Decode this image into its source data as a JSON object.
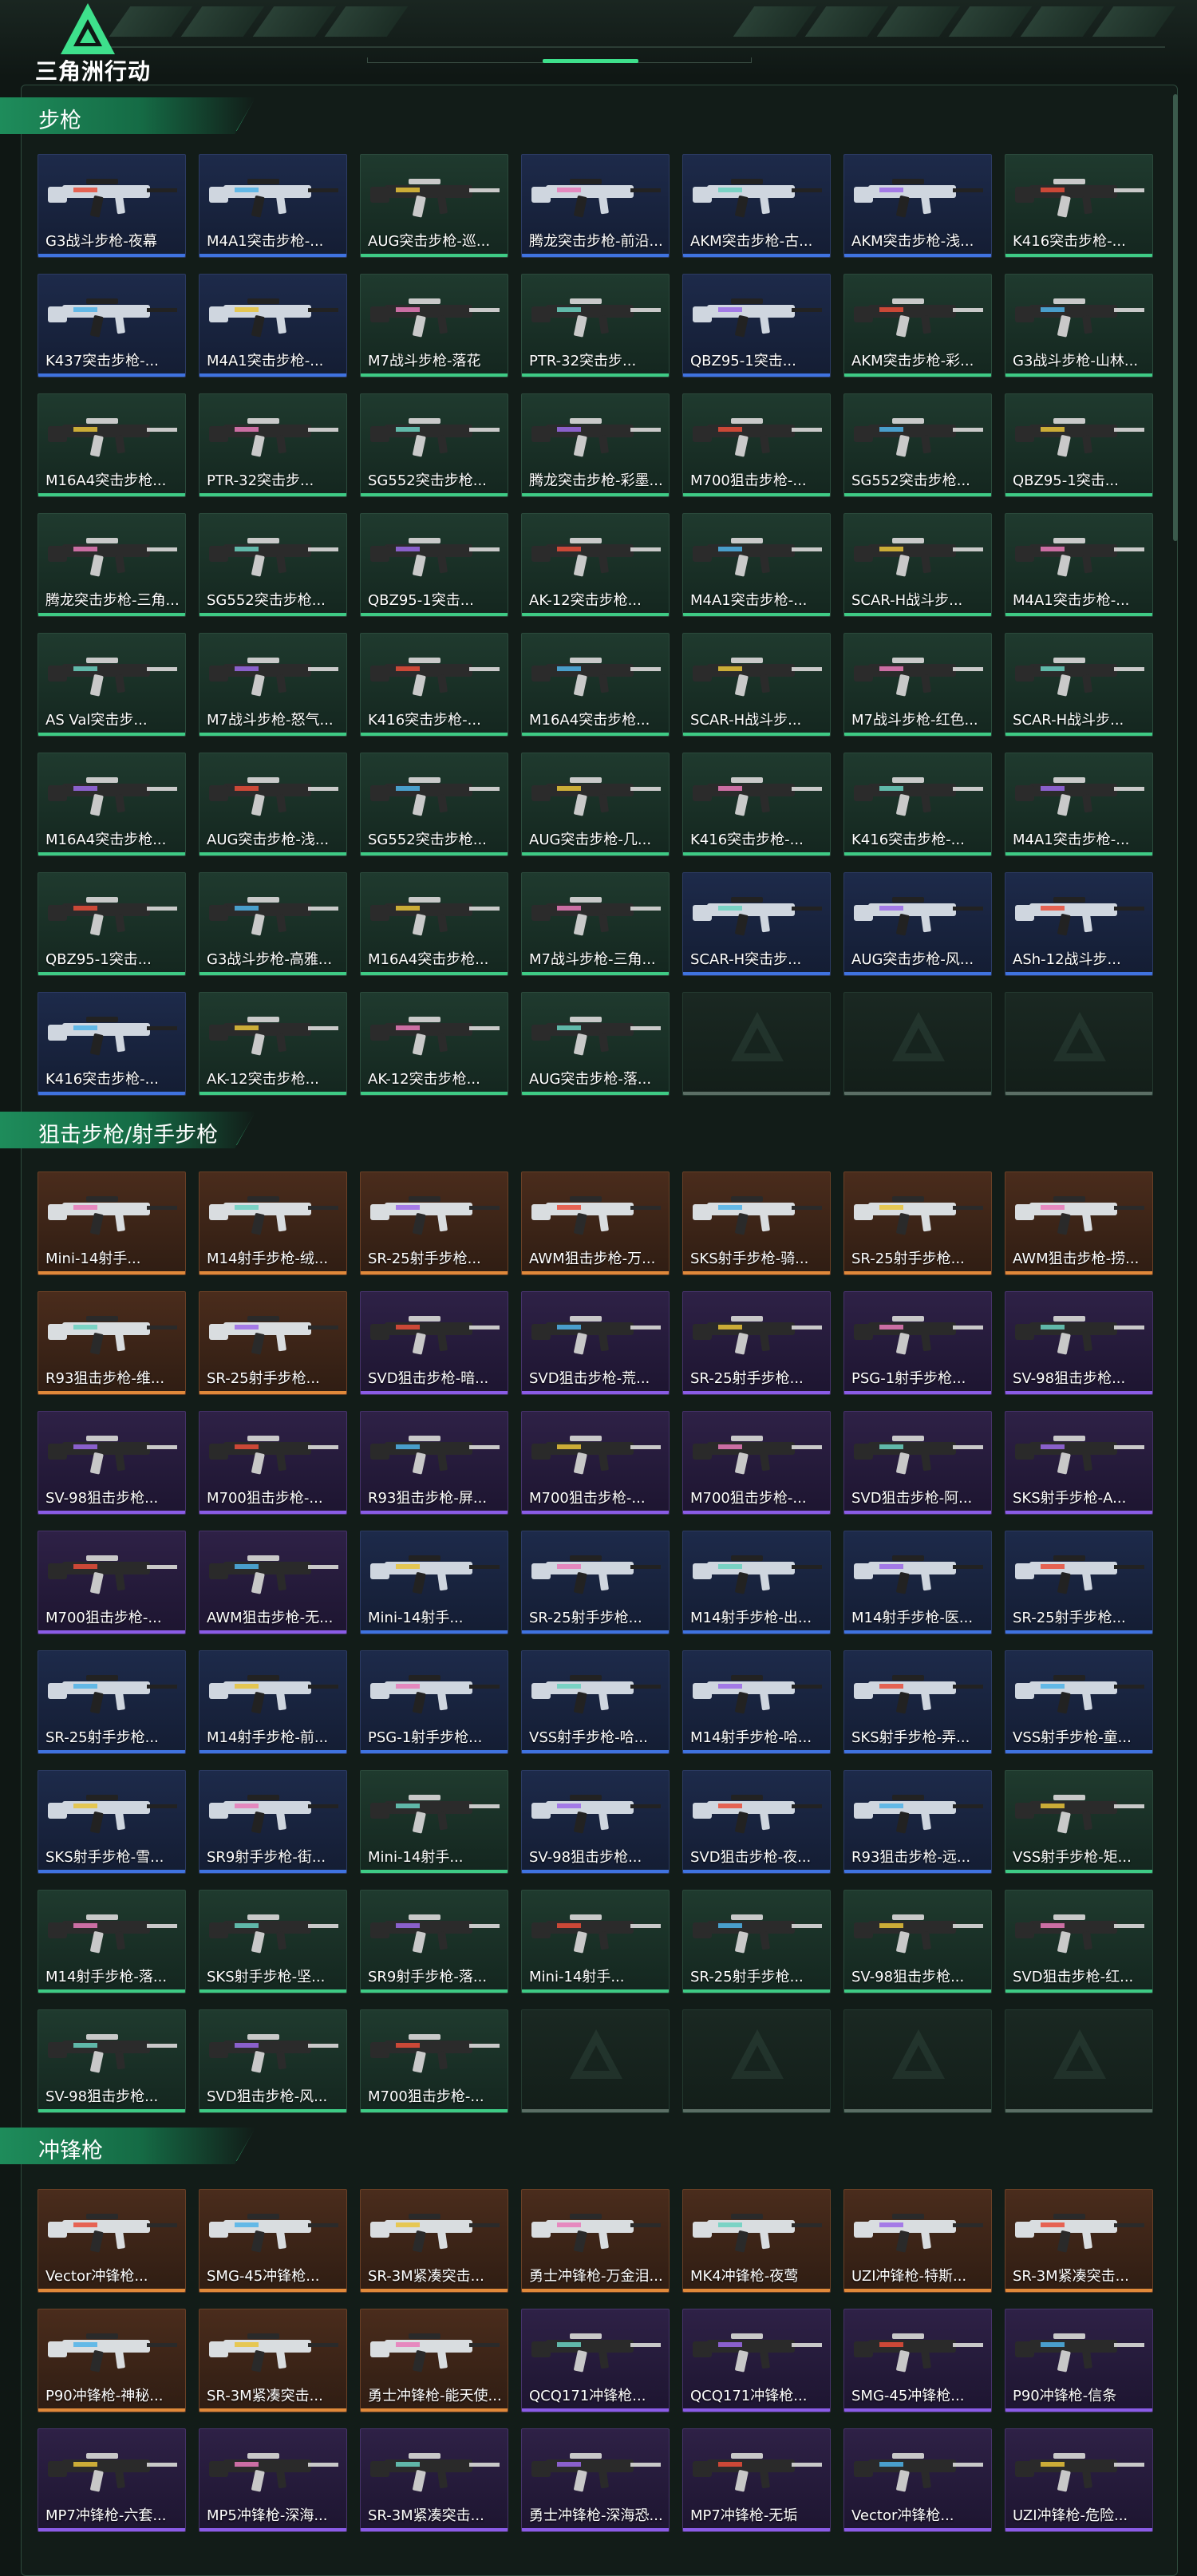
{
  "app": {
    "logo_text": "三角洲行动"
  },
  "colors": {
    "accent": "#3ee08c",
    "rarity_green": "#3ecb85",
    "rarity_blue": "#3f73e0",
    "rarity_purple": "#8a5ce6",
    "rarity_orange": "#e0893a"
  },
  "sections": [
    {
      "title": "步枪",
      "items": [
        {
          "label": "G3战斗步枪-夜幕",
          "rarity": "blue"
        },
        {
          "label": "M4A1突击步枪-...",
          "rarity": "blue"
        },
        {
          "label": "AUG突击步枪-巡...",
          "rarity": "green"
        },
        {
          "label": "腾龙突击步枪-前沿...",
          "rarity": "blue"
        },
        {
          "label": "AKM突击步枪-古...",
          "rarity": "blue"
        },
        {
          "label": "AKM突击步枪-浅...",
          "rarity": "blue"
        },
        {
          "label": "K416突击步枪-...",
          "rarity": "green"
        },
        {
          "label": "K437突击步枪-...",
          "rarity": "blue"
        },
        {
          "label": "M4A1突击步枪-...",
          "rarity": "blue"
        },
        {
          "label": "M7战斗步枪-落花",
          "rarity": "green"
        },
        {
          "label": "PTR-32突击步...",
          "rarity": "green"
        },
        {
          "label": "QBZ95-1突击...",
          "rarity": "blue"
        },
        {
          "label": "AKM突击步枪-彩...",
          "rarity": "green"
        },
        {
          "label": "G3战斗步枪-山林...",
          "rarity": "green"
        },
        {
          "label": "M16A4突击步枪...",
          "rarity": "green"
        },
        {
          "label": "PTR-32突击步...",
          "rarity": "green"
        },
        {
          "label": "SG552突击步枪...",
          "rarity": "green"
        },
        {
          "label": "腾龙突击步枪-彩墨...",
          "rarity": "green"
        },
        {
          "label": "M700狙击步枪-...",
          "rarity": "green"
        },
        {
          "label": "SG552突击步枪...",
          "rarity": "green"
        },
        {
          "label": "QBZ95-1突击...",
          "rarity": "green"
        },
        {
          "label": "腾龙突击步枪-三角...",
          "rarity": "green"
        },
        {
          "label": "SG552突击步枪...",
          "rarity": "green"
        },
        {
          "label": "QBZ95-1突击...",
          "rarity": "green"
        },
        {
          "label": "AK-12突击步枪...",
          "rarity": "green"
        },
        {
          "label": "M4A1突击步枪-...",
          "rarity": "green"
        },
        {
          "label": "SCAR-H战斗步...",
          "rarity": "green"
        },
        {
          "label": "M4A1突击步枪-...",
          "rarity": "green"
        },
        {
          "label": "AS Val突击步...",
          "rarity": "green"
        },
        {
          "label": "M7战斗步枪-怒气...",
          "rarity": "green"
        },
        {
          "label": "K416突击步枪-...",
          "rarity": "green"
        },
        {
          "label": "M16A4突击步枪...",
          "rarity": "green"
        },
        {
          "label": "SCAR-H战斗步...",
          "rarity": "green"
        },
        {
          "label": "M7战斗步枪-红色...",
          "rarity": "green"
        },
        {
          "label": "SCAR-H战斗步...",
          "rarity": "green"
        },
        {
          "label": "M16A4突击步枪...",
          "rarity": "green"
        },
        {
          "label": "AUG突击步枪-浅...",
          "rarity": "green"
        },
        {
          "label": "SG552突击步枪...",
          "rarity": "green"
        },
        {
          "label": "AUG突击步枪-几...",
          "rarity": "green"
        },
        {
          "label": "K416突击步枪-...",
          "rarity": "green"
        },
        {
          "label": "K416突击步枪-...",
          "rarity": "green"
        },
        {
          "label": "M4A1突击步枪-...",
          "rarity": "green"
        },
        {
          "label": "QBZ95-1突击...",
          "rarity": "green"
        },
        {
          "label": "G3战斗步枪-高雅...",
          "rarity": "green"
        },
        {
          "label": "M16A4突击步枪...",
          "rarity": "green"
        },
        {
          "label": "M7战斗步枪-三角...",
          "rarity": "green"
        },
        {
          "label": "SCAR-H突击步...",
          "rarity": "blue"
        },
        {
          "label": "AUG突击步枪-风...",
          "rarity": "blue"
        },
        {
          "label": "ASh-12战斗步...",
          "rarity": "blue"
        },
        {
          "label": "K416突击步枪-...",
          "rarity": "blue"
        },
        {
          "label": "AK-12突击步枪...",
          "rarity": "green"
        },
        {
          "label": "AK-12突击步枪...",
          "rarity": "green"
        },
        {
          "label": "AUG突击步枪-落...",
          "rarity": "green"
        },
        {
          "label": "",
          "rarity": "empty"
        },
        {
          "label": "",
          "rarity": "empty"
        },
        {
          "label": "",
          "rarity": "empty"
        }
      ]
    },
    {
      "title": "狙击步枪/射手步枪",
      "items": [
        {
          "label": "Mini-14射手...",
          "rarity": "orange"
        },
        {
          "label": "M14射手步枪-绒...",
          "rarity": "orange"
        },
        {
          "label": "SR-25射手步枪...",
          "rarity": "orange"
        },
        {
          "label": "AWM狙击步枪-万...",
          "rarity": "orange"
        },
        {
          "label": "SKS射手步枪-骑...",
          "rarity": "orange"
        },
        {
          "label": "SR-25射手步枪...",
          "rarity": "orange"
        },
        {
          "label": "AWM狙击步枪-捞...",
          "rarity": "orange"
        },
        {
          "label": "R93狙击步枪-维...",
          "rarity": "orange"
        },
        {
          "label": "SR-25射手步枪...",
          "rarity": "orange"
        },
        {
          "label": "SVD狙击步枪-暗...",
          "rarity": "purple"
        },
        {
          "label": "SVD狙击步枪-荒...",
          "rarity": "purple"
        },
        {
          "label": "SR-25射手步枪...",
          "rarity": "purple"
        },
        {
          "label": "PSG-1射手步枪...",
          "rarity": "purple"
        },
        {
          "label": "SV-98狙击步枪...",
          "rarity": "purple"
        },
        {
          "label": "SV-98狙击步枪...",
          "rarity": "purple"
        },
        {
          "label": "M700狙击步枪-...",
          "rarity": "purple"
        },
        {
          "label": "R93狙击步枪-屏...",
          "rarity": "purple"
        },
        {
          "label": "M700狙击步枪-...",
          "rarity": "purple"
        },
        {
          "label": "M700狙击步枪-...",
          "rarity": "purple"
        },
        {
          "label": "SVD狙击步枪-阿...",
          "rarity": "purple"
        },
        {
          "label": "SKS射手步枪-A...",
          "rarity": "purple"
        },
        {
          "label": "M700狙击步枪-...",
          "rarity": "purple"
        },
        {
          "label": "AWM狙击步枪-无...",
          "rarity": "purple"
        },
        {
          "label": "Mini-14射手...",
          "rarity": "blue"
        },
        {
          "label": "SR-25射手步枪...",
          "rarity": "blue"
        },
        {
          "label": "M14射手步枪-出...",
          "rarity": "blue"
        },
        {
          "label": "M14射手步枪-医...",
          "rarity": "blue"
        },
        {
          "label": "SR-25射手步枪...",
          "rarity": "blue"
        },
        {
          "label": "SR-25射手步枪...",
          "rarity": "blue"
        },
        {
          "label": "M14射手步枪-前...",
          "rarity": "blue"
        },
        {
          "label": "PSG-1射手步枪...",
          "rarity": "blue"
        },
        {
          "label": "VSS射手步枪-哈...",
          "rarity": "blue"
        },
        {
          "label": "M14射手步枪-哈...",
          "rarity": "blue"
        },
        {
          "label": "SKS射手步枪-弄...",
          "rarity": "blue"
        },
        {
          "label": "VSS射手步枪-童...",
          "rarity": "blue"
        },
        {
          "label": "SKS射手步枪-雪...",
          "rarity": "blue"
        },
        {
          "label": "SR9射手步枪-街...",
          "rarity": "blue"
        },
        {
          "label": "Mini-14射手...",
          "rarity": "green"
        },
        {
          "label": "SV-98狙击步枪...",
          "rarity": "blue"
        },
        {
          "label": "SVD狙击步枪-夜...",
          "rarity": "blue"
        },
        {
          "label": "R93狙击步枪-远...",
          "rarity": "blue"
        },
        {
          "label": "VSS射手步枪-矩...",
          "rarity": "green"
        },
        {
          "label": "M14射手步枪-落...",
          "rarity": "green"
        },
        {
          "label": "SKS射手步枪-坚...",
          "rarity": "green"
        },
        {
          "label": "SR9射手步枪-落...",
          "rarity": "green"
        },
        {
          "label": "Mini-14射手...",
          "rarity": "green"
        },
        {
          "label": "SR-25射手步枪...",
          "rarity": "green"
        },
        {
          "label": "SV-98狙击步枪...",
          "rarity": "green"
        },
        {
          "label": "SVD狙击步枪-红...",
          "rarity": "green"
        },
        {
          "label": "SV-98狙击步枪...",
          "rarity": "green"
        },
        {
          "label": "SVD狙击步枪-风...",
          "rarity": "green"
        },
        {
          "label": "M700狙击步枪-...",
          "rarity": "green"
        },
        {
          "label": "",
          "rarity": "empty"
        },
        {
          "label": "",
          "rarity": "empty"
        },
        {
          "label": "",
          "rarity": "empty"
        },
        {
          "label": "",
          "rarity": "empty"
        }
      ]
    },
    {
      "title": "冲锋枪",
      "items": [
        {
          "label": "Vector冲锋枪...",
          "rarity": "orange"
        },
        {
          "label": "SMG-45冲锋枪...",
          "rarity": "orange"
        },
        {
          "label": "SR-3M紧凑突击...",
          "rarity": "orange"
        },
        {
          "label": "勇士冲锋枪-万金泪...",
          "rarity": "orange"
        },
        {
          "label": "MK4冲锋枪-夜莺",
          "rarity": "orange"
        },
        {
          "label": "UZI冲锋枪-特斯...",
          "rarity": "orange"
        },
        {
          "label": "SR-3M紧凑突击...",
          "rarity": "orange"
        },
        {
          "label": "P90冲锋枪-神秘...",
          "rarity": "orange"
        },
        {
          "label": "SR-3M紧凑突击...",
          "rarity": "orange"
        },
        {
          "label": "勇士冲锋枪-能天使...",
          "rarity": "orange"
        },
        {
          "label": "QCQ171冲锋枪...",
          "rarity": "purple"
        },
        {
          "label": "QCQ171冲锋枪...",
          "rarity": "purple"
        },
        {
          "label": "SMG-45冲锋枪...",
          "rarity": "purple"
        },
        {
          "label": "P90冲锋枪-信条",
          "rarity": "purple"
        },
        {
          "label": "MP7冲锋枪-六套...",
          "rarity": "purple"
        },
        {
          "label": "MP5冲锋枪-深海...",
          "rarity": "purple"
        },
        {
          "label": "SR-3M紧凑突击...",
          "rarity": "purple"
        },
        {
          "label": "勇士冲锋枪-深海恐...",
          "rarity": "purple"
        },
        {
          "label": "MP7冲锋枪-无垢",
          "rarity": "purple"
        },
        {
          "label": "Vector冲锋枪...",
          "rarity": "purple"
        },
        {
          "label": "UZI冲锋枪-危险...",
          "rarity": "purple"
        }
      ]
    }
  ]
}
